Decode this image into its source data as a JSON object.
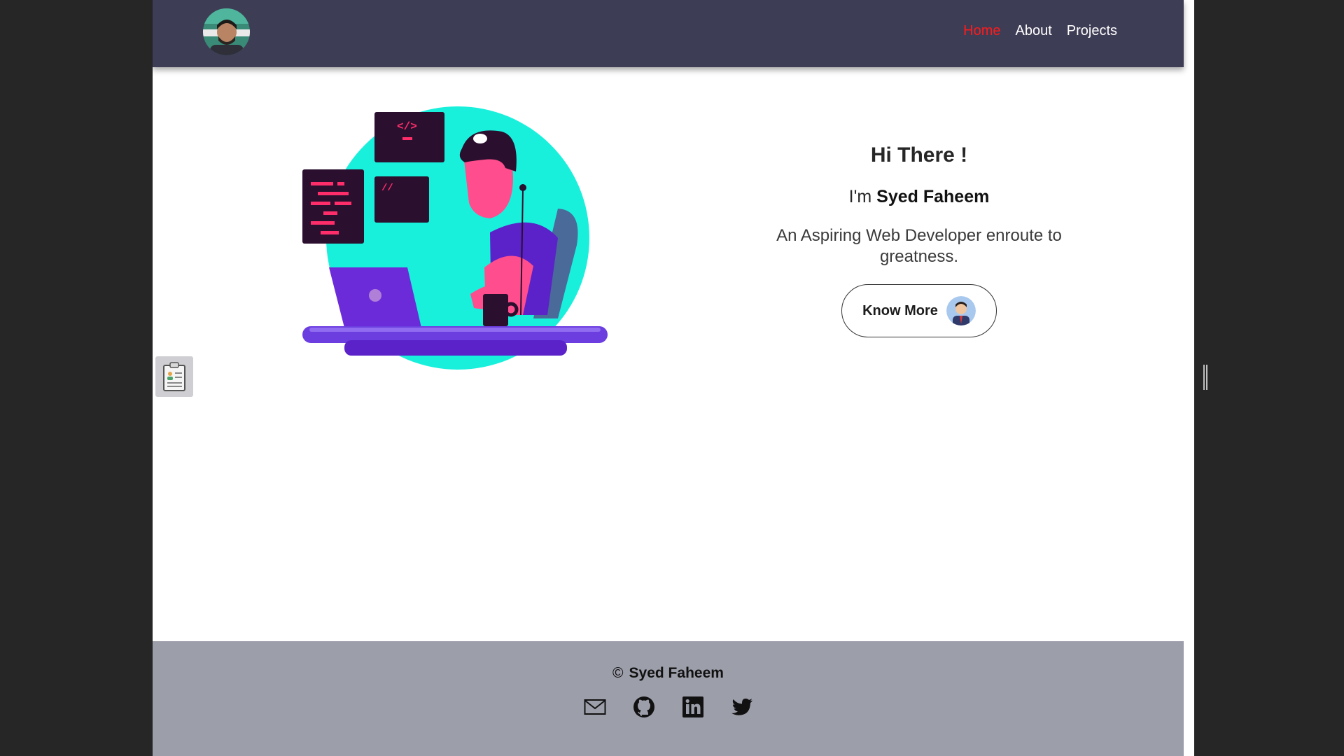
{
  "nav": {
    "avatar_icon": "profile-photo",
    "links": [
      {
        "label": "Home",
        "active": true
      },
      {
        "label": "About",
        "active": false
      },
      {
        "label": "Projects",
        "active": false
      }
    ],
    "active_color": "#ff1a1a",
    "background": "#3e3d56"
  },
  "hero": {
    "title": "Hi There !",
    "greeting_prefix": "I'm",
    "name": "Syed Faheem",
    "description": "An Aspiring Web Developer enroute to greatness.",
    "button_label": "Know More",
    "button_icon": "avatar-icon",
    "illustration_icon": "developer-illustration"
  },
  "resume_tab": {
    "icon": "clipboard-resume-icon"
  },
  "footer": {
    "copyright_symbol": "©",
    "copyright_name": "Syed Faheem",
    "social_icons": [
      "mail-icon",
      "github-icon",
      "linkedin-icon",
      "twitter-icon"
    ],
    "background": "#9c9eaa"
  },
  "colors": {
    "accent_cyan": "#19f0dc",
    "accent_purple": "#5a22c8",
    "accent_pink": "#ff4d8d"
  }
}
